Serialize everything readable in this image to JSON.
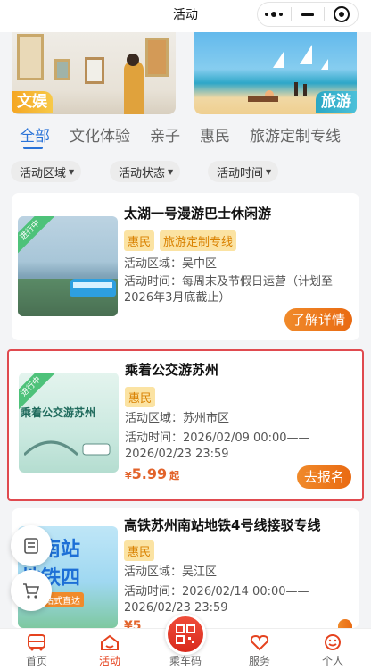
{
  "header": {
    "title": "活动"
  },
  "banners": [
    {
      "tag": "文娱"
    },
    {
      "tag": "旅游"
    }
  ],
  "tabs": [
    {
      "label": "全部",
      "active": true
    },
    {
      "label": "文化体验"
    },
    {
      "label": "亲子"
    },
    {
      "label": "惠民"
    },
    {
      "label": "旅游定制专线"
    }
  ],
  "filters": [
    {
      "label": "活动区域"
    },
    {
      "label": "活动状态"
    },
    {
      "label": "活动时间"
    }
  ],
  "cards": [
    {
      "ribbon": "进行中",
      "title": "太湖一号漫游巴士休闲游",
      "badges": [
        "惠民",
        "旅游定制专线"
      ],
      "area": "活动区域：吴中区",
      "time_line1": "活动时间：每周末及节假日运营（计划至",
      "time_line2": "2026年3月底截止）",
      "action": "了解详情"
    },
    {
      "ribbon": "进行中",
      "title": "乘着公交游苏州",
      "badges": [
        "惠民"
      ],
      "area": "活动区域：苏州市区",
      "time_line1": "活动时间：2026/02/09 00:00——",
      "time_line2": "2026/02/23 23:59",
      "price_currency": "¥",
      "price_value": "5.99",
      "price_suffix": "起",
      "action": "去报名",
      "thumb_text": "乘着公交游苏州"
    },
    {
      "title": "高铁苏州南站地铁4号线接驳专线",
      "badges": [
        "惠民"
      ],
      "area": "活动区域：吴江区",
      "time_line1": "活动时间：2026/02/14 00:00——",
      "time_line2": "2026/02/23 23:59",
      "price_partial": "¥5",
      "thumb_line1": "州南站",
      "thumb_line2": "地铁四",
      "thumb_line3": "一站式直达"
    }
  ],
  "nav": [
    {
      "label": "首页",
      "icon": "bus-icon"
    },
    {
      "label": "活动",
      "icon": "home-activity-icon",
      "active": true
    },
    {
      "label": "乘车码",
      "icon": "qr-code-icon"
    },
    {
      "label": "服务",
      "icon": "heart-service-icon"
    },
    {
      "label": "个人",
      "icon": "person-icon"
    }
  ],
  "colors": {
    "accent_blue": "#2a73d8",
    "accent_orange": "#e96a12",
    "badge_bg": "#fbe3a3",
    "highlight_border": "#e04a4f",
    "nav_red": "#e5431f"
  }
}
